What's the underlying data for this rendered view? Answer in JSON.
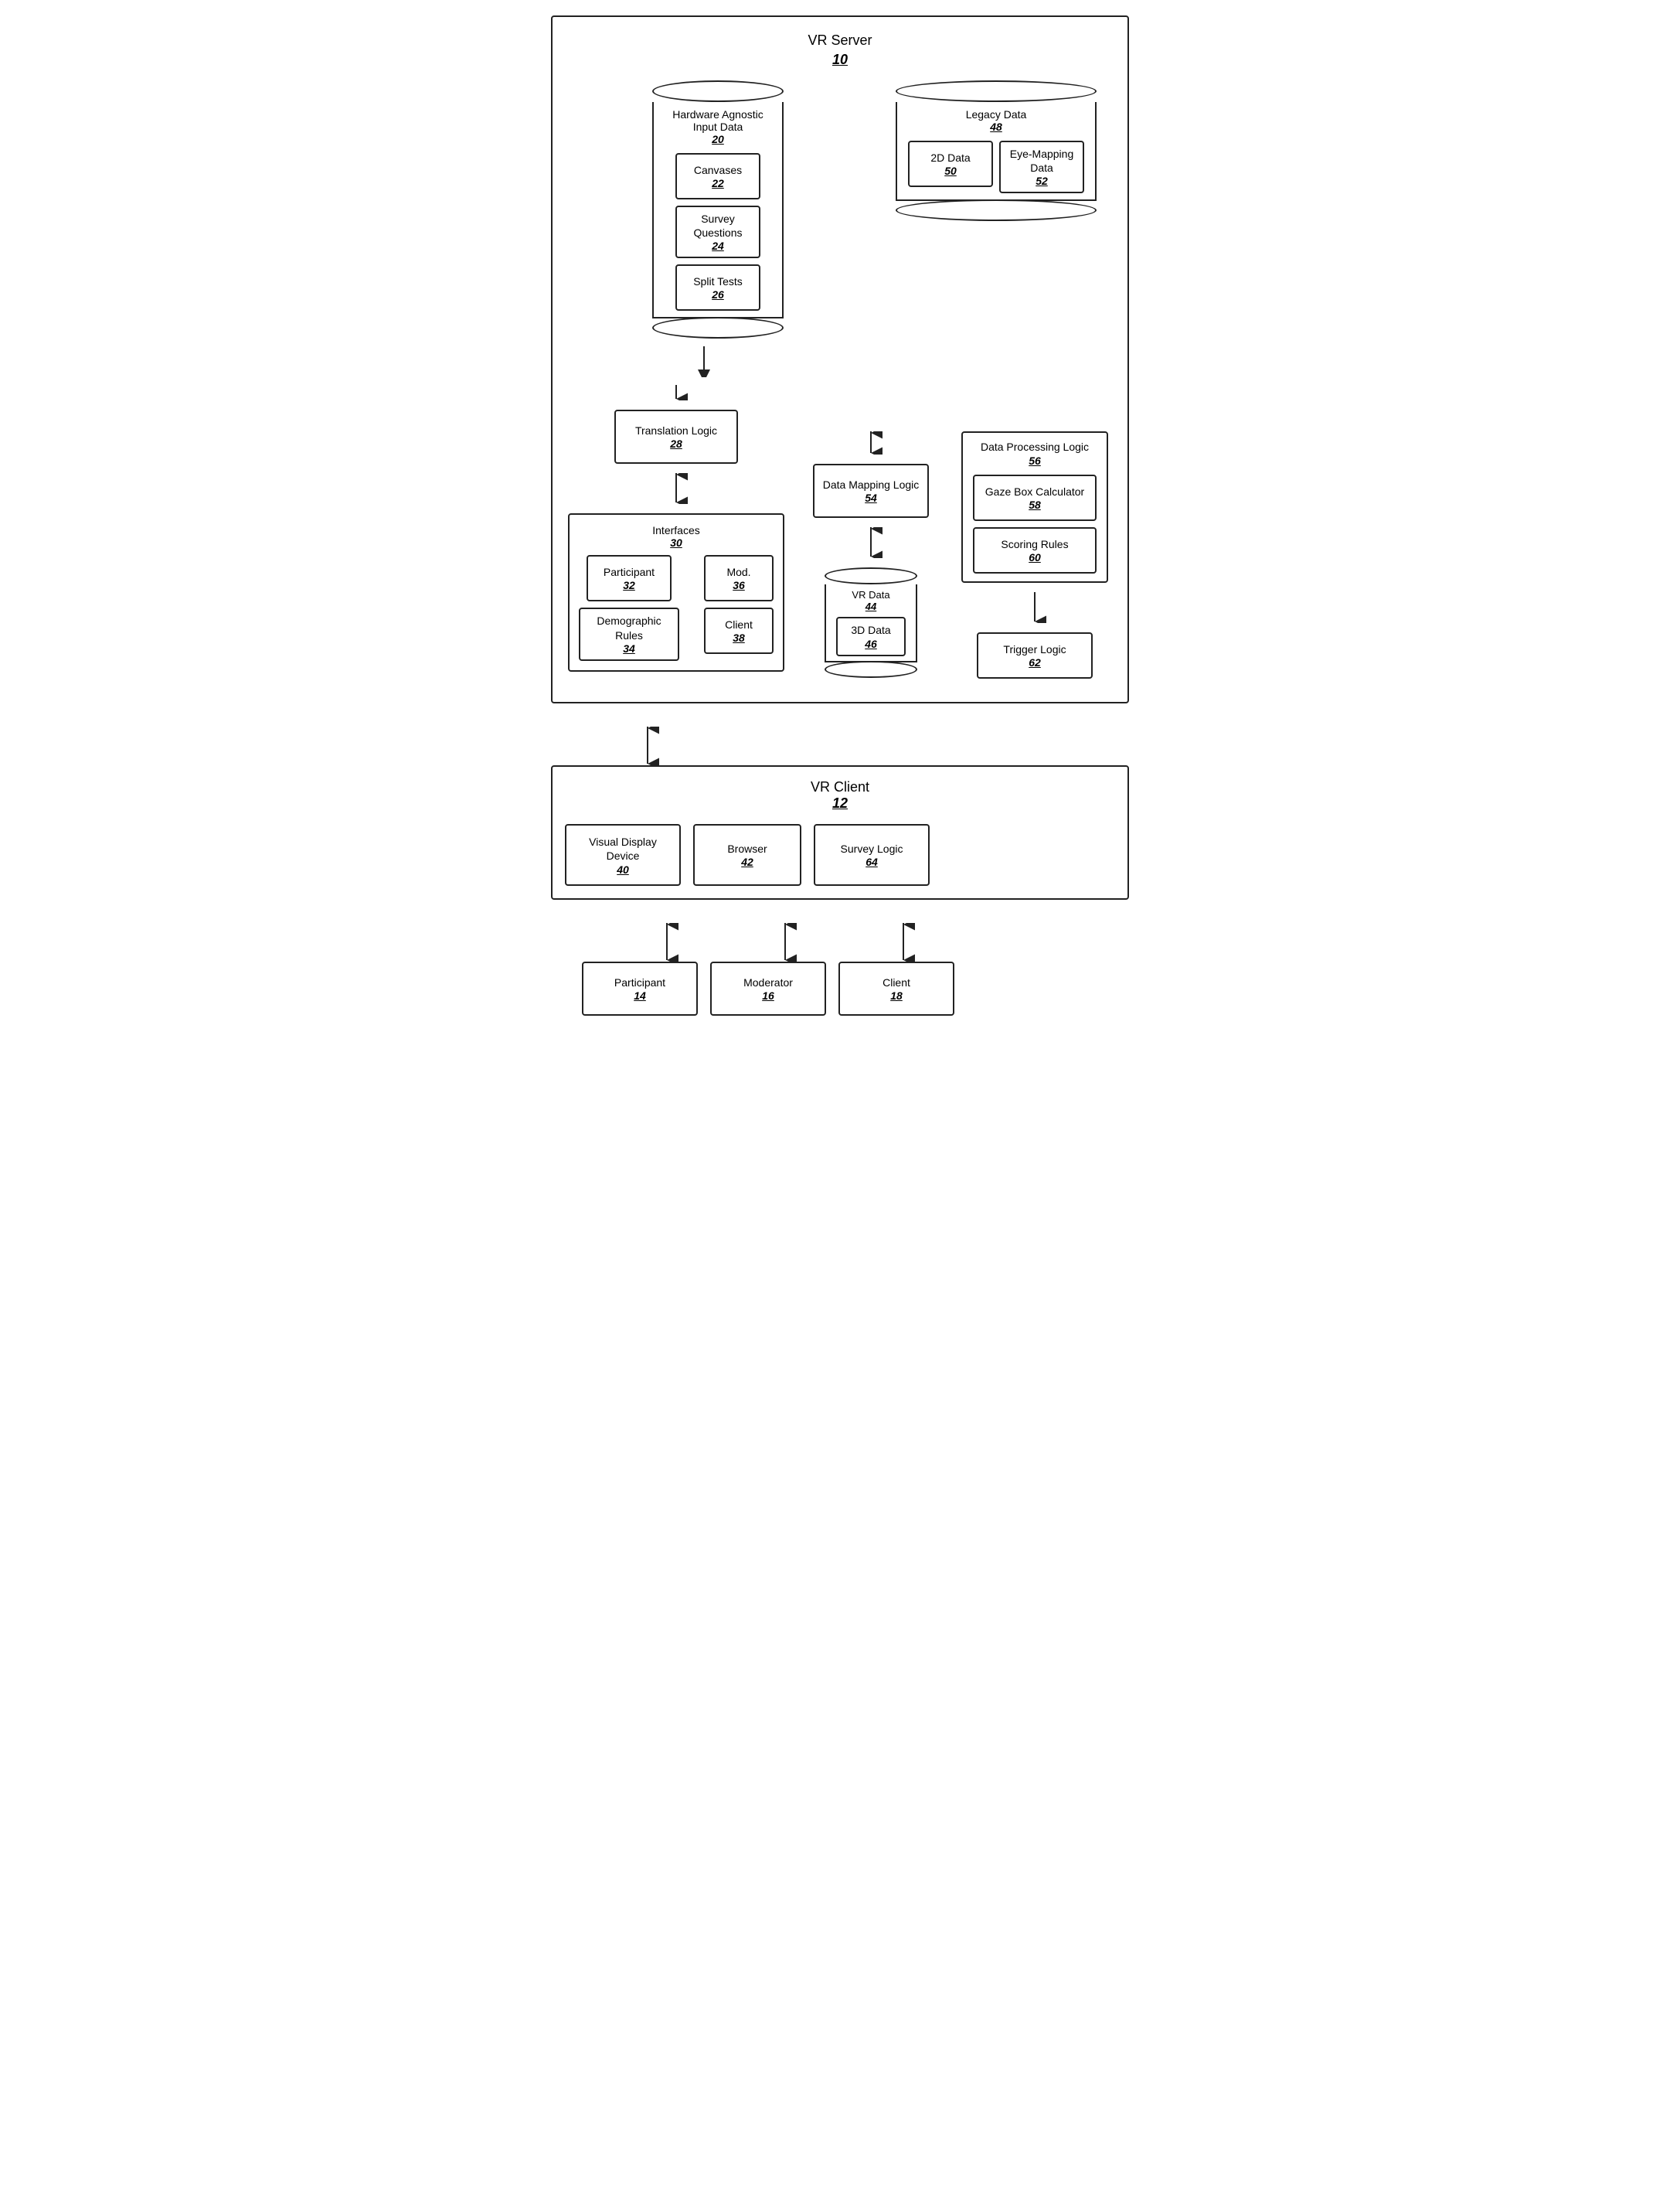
{
  "diagram": {
    "title": "VR Server",
    "title_num": "10",
    "client_title": "VR Client",
    "client_num": "12",
    "hardware_db": {
      "label": "Hardware Agnostic Input Data",
      "num": "20"
    },
    "legacy_db": {
      "label": "Legacy Data",
      "num": "48"
    },
    "canvases": {
      "label": "Canvases",
      "num": "22"
    },
    "survey_questions": {
      "label": "Survey Questions",
      "num": "24"
    },
    "split_tests": {
      "label": "Split Tests",
      "num": "26"
    },
    "two_d_data": {
      "label": "2D Data",
      "num": "50"
    },
    "eye_mapping": {
      "label": "Eye-Mapping Data",
      "num": "52"
    },
    "translation_logic": {
      "label": "Translation Logic",
      "num": "28"
    },
    "data_mapping": {
      "label": "Data Mapping Logic",
      "num": "54"
    },
    "data_processing": {
      "label": "Data Processing Logic",
      "num": "56"
    },
    "interfaces": {
      "label": "Interfaces",
      "num": "30"
    },
    "participant_inner": {
      "label": "Participant",
      "num": "32"
    },
    "demographic": {
      "label": "Demographic Rules",
      "num": "34"
    },
    "mod": {
      "label": "Mod.",
      "num": "36"
    },
    "client_inner": {
      "label": "Client",
      "num": "38"
    },
    "vr_data": {
      "label": "VR Data",
      "num": "44"
    },
    "three_d_data": {
      "label": "3D Data",
      "num": "46"
    },
    "gaze_box": {
      "label": "Gaze Box Calculator",
      "num": "58"
    },
    "scoring_rules": {
      "label": "Scoring Rules",
      "num": "60"
    },
    "trigger_logic": {
      "label": "Trigger Logic",
      "num": "62"
    },
    "visual_display": {
      "label": "Visual Display Device",
      "num": "40"
    },
    "browser": {
      "label": "Browser",
      "num": "42"
    },
    "survey_logic": {
      "label": "Survey Logic",
      "num": "64"
    },
    "participant_bottom": {
      "label": "Participant",
      "num": "14"
    },
    "moderator": {
      "label": "Moderator",
      "num": "16"
    },
    "client_bottom": {
      "label": "Client",
      "num": "18"
    }
  }
}
